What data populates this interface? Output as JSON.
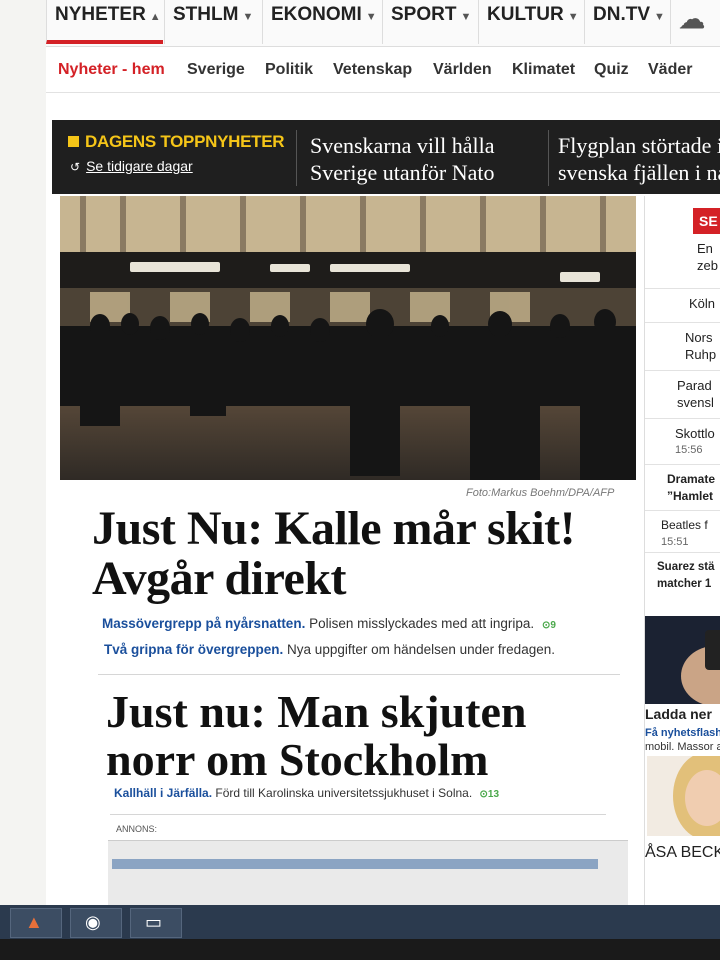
{
  "topnav": {
    "items": [
      {
        "label": "NYHETER",
        "active": true
      },
      {
        "label": "STHLM"
      },
      {
        "label": "EKONOMI"
      },
      {
        "label": "SPORT"
      },
      {
        "label": "KULTUR"
      },
      {
        "label": "DN.TV"
      }
    ],
    "weather_icon": "cloud-icon"
  },
  "subnav": {
    "items": [
      "Nyheter - hem",
      "Sverige",
      "Politik",
      "Vetenskap",
      "Världen",
      "Klimatet",
      "Quiz",
      "Väder"
    ]
  },
  "topbar": {
    "badge": "DAGENS TOPPNYHETER",
    "previous_days": "Se tidigare dagar",
    "stories": [
      {
        "line1": "Svenskarna vill hålla",
        "line2": "Sverige utanför Nato"
      },
      {
        "line1": "Flygplan störtade i",
        "line2": "svenska fjällen i na"
      }
    ]
  },
  "hero": {
    "photo_credit": "Foto:Markus Boehm/DPA/AFP",
    "headline": "Just Nu: Kalle mår skit! Avgår direkt",
    "sublinks": [
      {
        "link": "Massövergrepp på nyårsnatten.",
        "text": " Polisen misslyckades med att ingripa.",
        "count": "9"
      },
      {
        "link": "Två gripna för övergreppen.",
        "text": " Nya uppgifter om händelsen under fredagen.",
        "count": ""
      }
    ]
  },
  "second": {
    "headline": "Just nu: Man skjuten norr om Stockholm",
    "link": "Kallhäll i Järfälla.",
    "text": " Förd till Karolinska universitetssjukhuset i Solna.",
    "count": "13"
  },
  "annons": "ANNONS:",
  "sidebar": {
    "label": "SE",
    "items": [
      {
        "line1": "En",
        "line2": "zeb",
        "time": ""
      },
      {
        "line1": "Köln",
        "line2": "",
        "time": ""
      },
      {
        "line1": "Nors",
        "line2": "Ruhp",
        "time": ""
      },
      {
        "line1": "Parad",
        "line2": "svensl",
        "time": ""
      },
      {
        "line1": "Skottlo",
        "line2": "",
        "time": "15:56"
      },
      {
        "line1": "Dramate",
        "line2": "”Hamlet",
        "time": ""
      },
      {
        "line1": "Beatles f",
        "line2": "",
        "time": "15:51"
      },
      {
        "line1": "Suarez stä",
        "line2": "matcher 1",
        "time": ""
      }
    ],
    "ladda": "Ladda ner",
    "ladda_link": "Få nyhetsflash",
    "ladda_text": "mobil. Massor a",
    "columnist": "ÅSA BECKM"
  },
  "taskbar": {
    "buttons": [
      "matlab-icon",
      "chrome-icon",
      "window-icon"
    ]
  }
}
